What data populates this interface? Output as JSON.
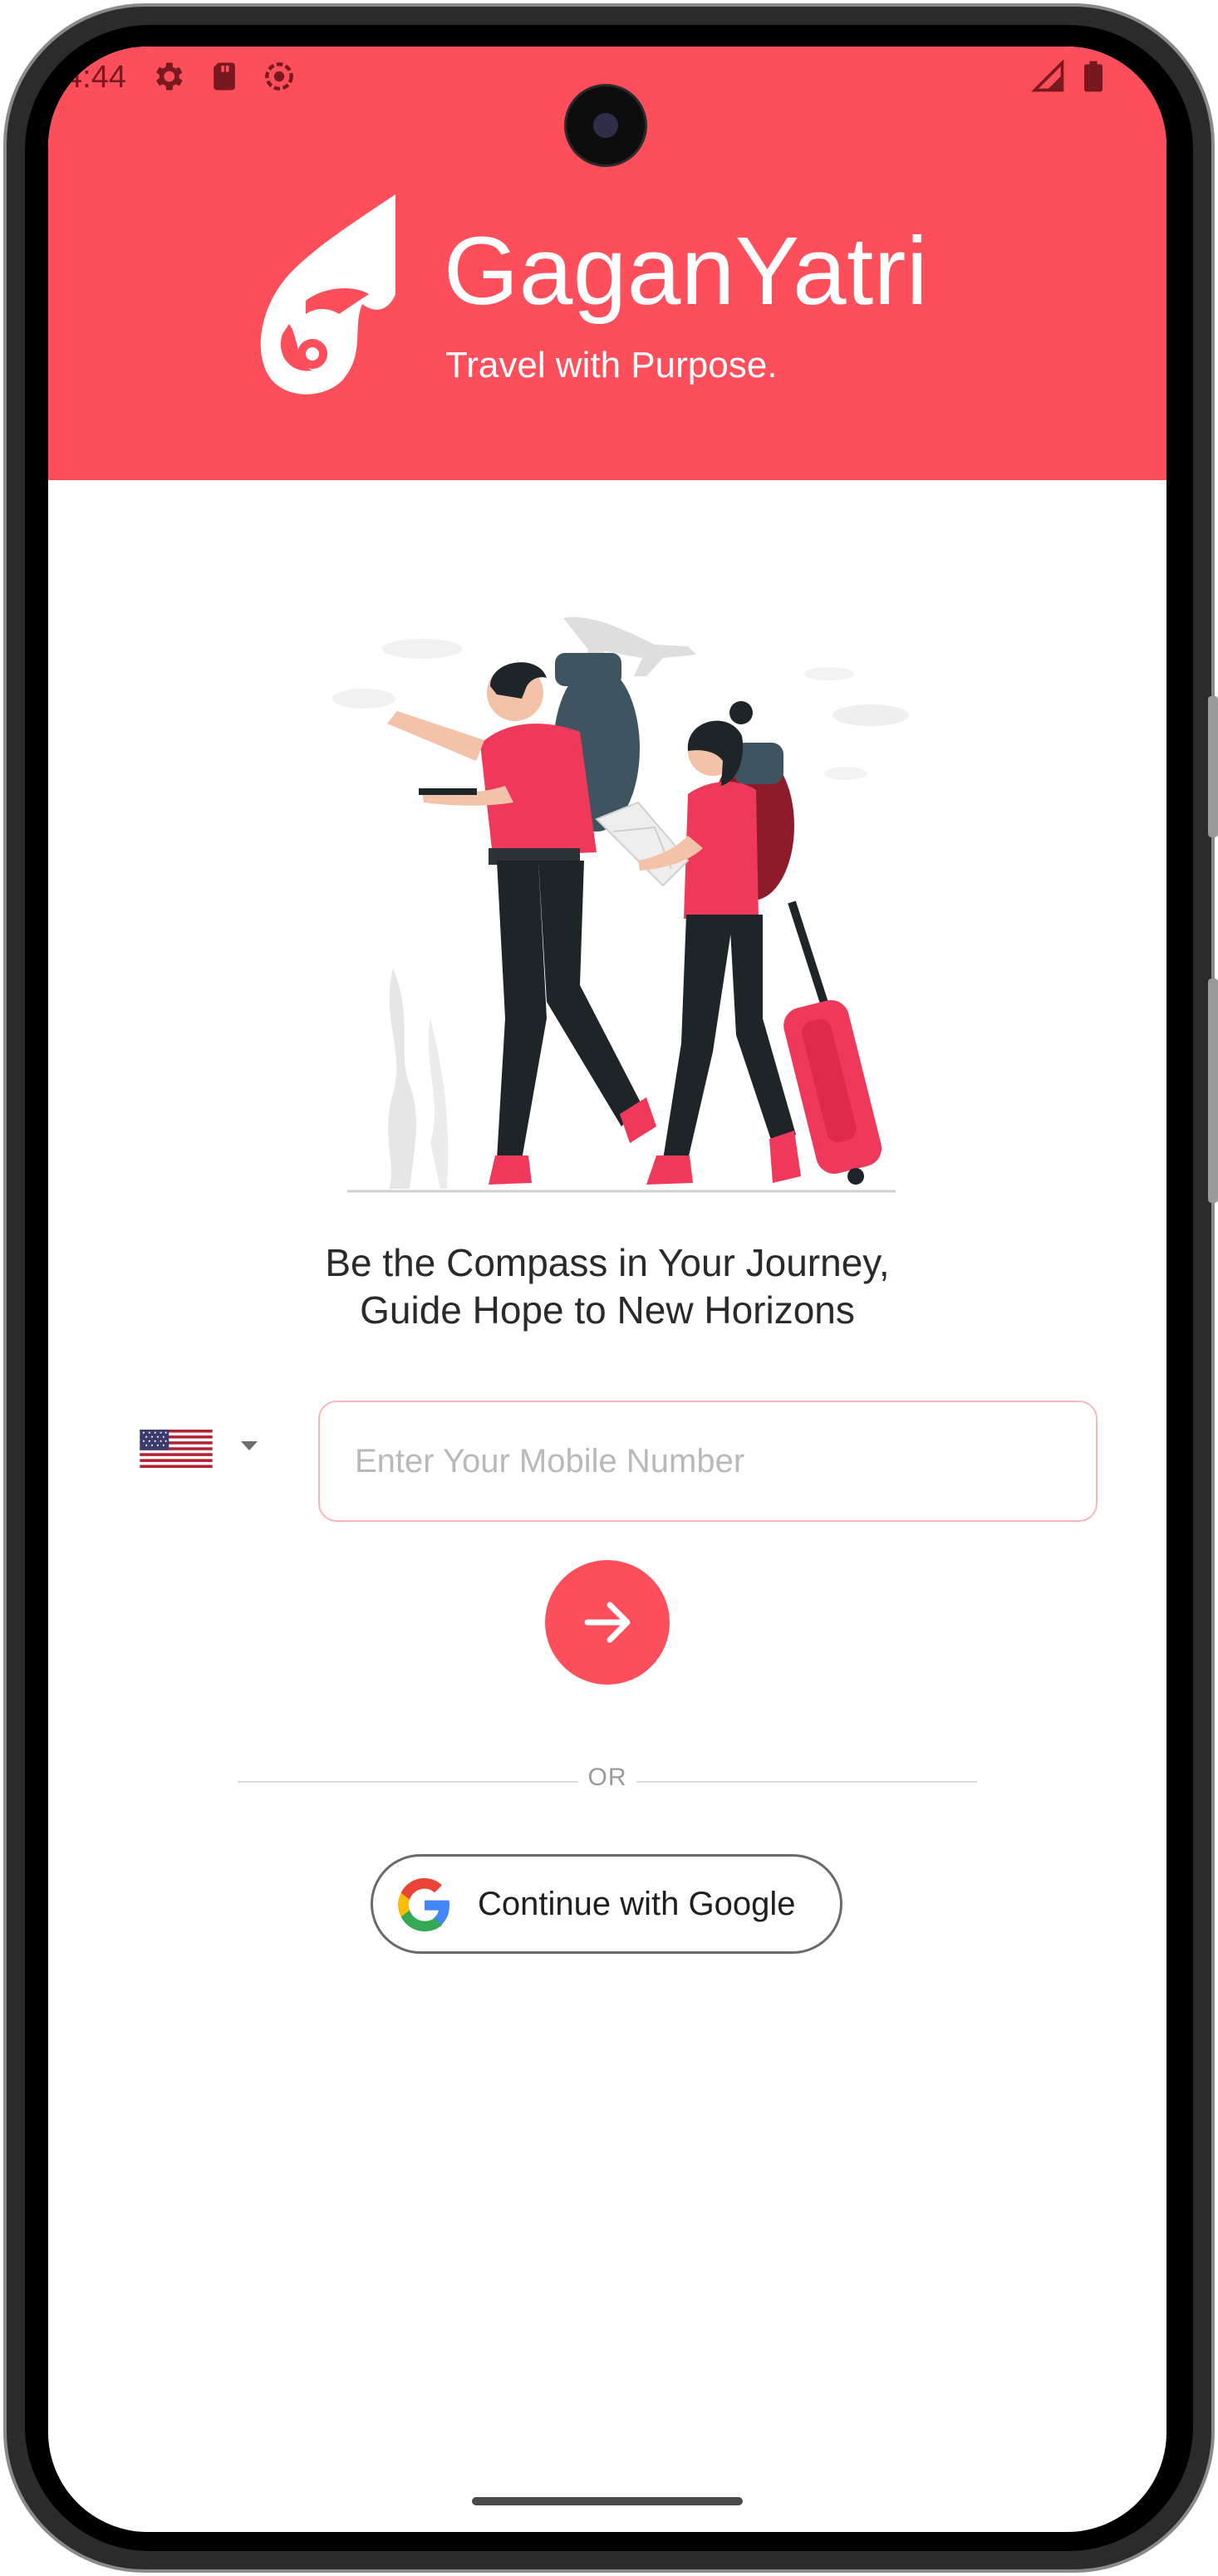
{
  "status_bar": {
    "time": "4:44",
    "left_icons": [
      "gear-icon",
      "sd-card-icon",
      "settings-sync-icon"
    ],
    "right_icons": [
      "signal-icon",
      "battery-icon"
    ]
  },
  "header": {
    "brand_name": "GaganYatri",
    "tagline": "Travel with Purpose.",
    "background_color": "#fd4e5b"
  },
  "illustration": {
    "icon": "travelers-illustration"
  },
  "main": {
    "headline_line1": "Be the Compass in Your Journey,",
    "headline_line2": "Guide Hope to New Horizons",
    "country_code": {
      "flag": "us-flag-icon",
      "selected": "United States"
    },
    "mobile_input": {
      "value": "",
      "placeholder": "Enter Your Mobile Number"
    },
    "next_button": {
      "icon": "arrow-right-icon"
    },
    "divider_text": "OR",
    "google_button": {
      "label": "Continue with Google",
      "icon": "google-logo-icon"
    }
  }
}
